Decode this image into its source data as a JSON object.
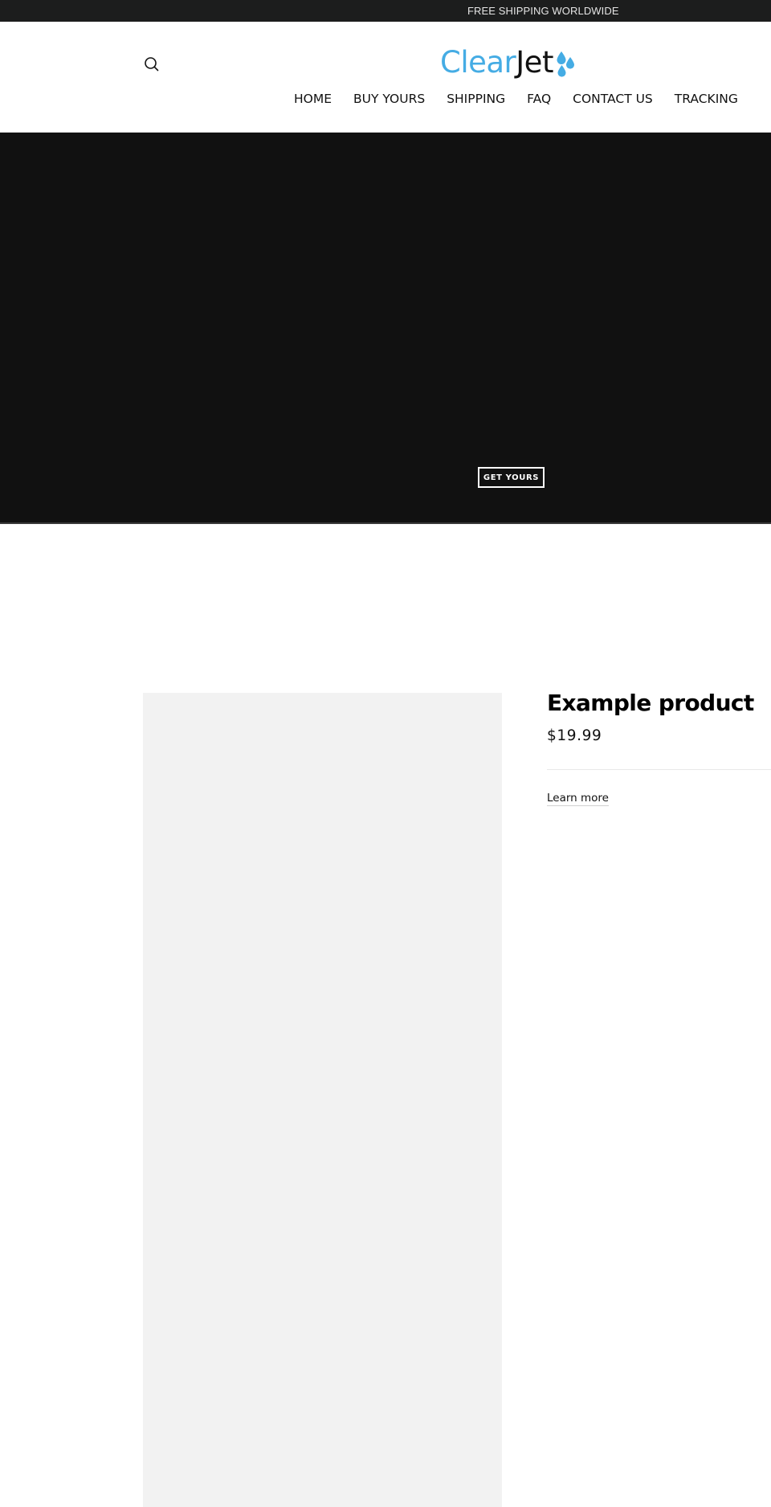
{
  "announcement": {
    "text": "FREE SHIPPING WORLDWIDE"
  },
  "header": {
    "search_icon": "search-icon",
    "logo": {
      "part1": "Clear",
      "part2": "Jet",
      "icon": "water-droplets-icon",
      "color_primary": "#45ace4",
      "color_secondary": "#111111"
    },
    "nav": [
      {
        "label": "HOME"
      },
      {
        "label": "BUY YOURS"
      },
      {
        "label": "SHIPPING"
      },
      {
        "label": "FAQ"
      },
      {
        "label": "CONTACT US"
      },
      {
        "label": "TRACKING"
      }
    ]
  },
  "hero": {
    "background_color": "#111111",
    "cta_label": "GET YOURS"
  },
  "product": {
    "title": "Example product",
    "price": "$19.99",
    "learn_more_label": "Learn more",
    "image_placeholder_color": "#f2f2f2"
  }
}
